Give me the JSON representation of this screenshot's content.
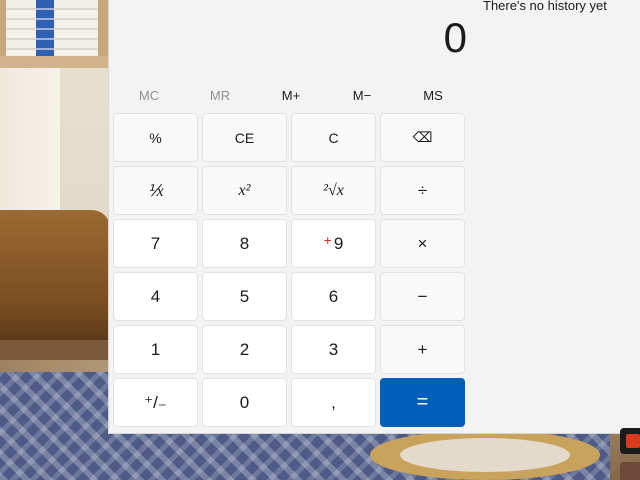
{
  "display": {
    "value": "0"
  },
  "history": {
    "empty_text": "There's no history yet"
  },
  "memory": {
    "mc": "MC",
    "mr": "MR",
    "m_plus": "M+",
    "m_minus": "M−",
    "ms": "MS"
  },
  "keys": {
    "percent": "%",
    "ce": "CE",
    "c": "C",
    "backspace": "⌫",
    "reciprocal": "⅟x",
    "square": "x²",
    "sqrt": "²√x",
    "divide": "÷",
    "seven": "7",
    "eight": "8",
    "nine": "9",
    "multiply": "×",
    "four": "4",
    "five": "5",
    "six": "6",
    "minus": "−",
    "one": "1",
    "two": "2",
    "three": "3",
    "plus": "+",
    "negate": "⁺/₋",
    "zero": "0",
    "decimal": ",",
    "equals": "="
  },
  "cursor": {
    "symbol": "+"
  },
  "colors": {
    "accent": "#005fb8",
    "window_bg": "#f3f3f3",
    "key_bg": "#ffffff"
  }
}
